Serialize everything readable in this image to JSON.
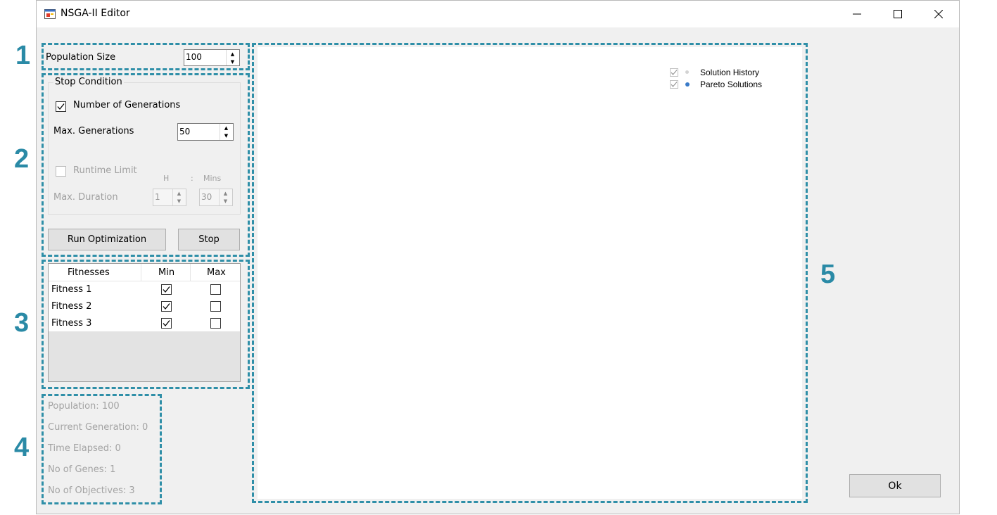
{
  "window": {
    "title": "NSGA-II Editor"
  },
  "callouts": [
    "1",
    "2",
    "3",
    "4",
    "5"
  ],
  "population": {
    "label": "Population Size",
    "value": "100"
  },
  "stop_condition": {
    "group_label": "Stop Condition",
    "num_generations_label": "Number of Generations",
    "num_generations_checked": true,
    "max_generations_label": "Max. Generations",
    "max_generations_value": "50",
    "runtime_limit_label": "Runtime Limit",
    "runtime_limit_checked": false,
    "hours_header": "H",
    "separator": ":",
    "mins_header": "Mins",
    "max_duration_label": "Max. Duration",
    "hours_value": "1",
    "mins_value": "30"
  },
  "buttons": {
    "run": "Run Optimization",
    "stop": "Stop",
    "ok": "Ok"
  },
  "fitness_table": {
    "headers": [
      "Fitnesses",
      "Min",
      "Max"
    ],
    "rows": [
      {
        "name": "Fitness 1",
        "min": true,
        "max": false
      },
      {
        "name": "Fitness 2",
        "min": true,
        "max": false
      },
      {
        "name": "Fitness 3",
        "min": true,
        "max": false
      }
    ]
  },
  "stats": {
    "population": "Population: 100",
    "current_generation": "Current Generation: 0",
    "time_elapsed": "Time Elapsed: 0",
    "no_of_genes": "No of Genes: 1",
    "no_of_objectives": "No of Objectives: 3"
  },
  "chart_legend": {
    "items": [
      {
        "name": "Solution History",
        "color": "#d3d3d3"
      },
      {
        "name": "Pareto Solutions",
        "color": "#3a7bc8"
      }
    ]
  },
  "colors": {
    "callout": "#2a8aa6"
  }
}
